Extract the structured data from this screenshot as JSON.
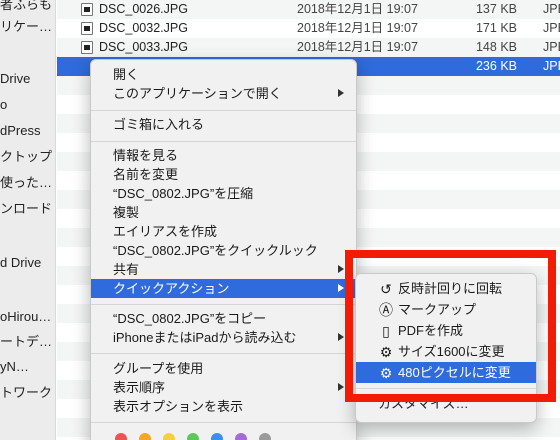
{
  "sidebar": {
    "items": [
      {
        "label": "者ふらも"
      },
      {
        "label": "リケー…"
      },
      {
        "label": "Drive"
      },
      {
        "label": "o"
      },
      {
        "label": "dPress"
      },
      {
        "label": "クトップ"
      },
      {
        "label": "使った…"
      },
      {
        "label": "ンロード"
      },
      {
        "label": "d Drive"
      },
      {
        "label": "oHirou…"
      },
      {
        "label": "ートデ…"
      },
      {
        "label": "yN…"
      },
      {
        "label": "トワーク"
      }
    ]
  },
  "files": [
    {
      "name": "DSC_0026.JPG",
      "date": "2018年12月1日 19:07",
      "size": "137 KB",
      "kind": "JPE"
    },
    {
      "name": "DSC_0032.JPG",
      "date": "2018年12月1日 19:07",
      "size": "171 KB",
      "kind": "JPE"
    },
    {
      "name": "DSC_0033.JPG",
      "date": "2018年12月1日 19:07",
      "size": "148 KB",
      "kind": "JPE"
    },
    {
      "name": "",
      "date": "",
      "size": "236 KB",
      "kind": "JPE"
    }
  ],
  "context_menu": {
    "open": "開く",
    "open_with": "このアプリケーションで開く",
    "trash": "ゴミ箱に入れる",
    "get_info": "情報を見る",
    "rename": "名前を変更",
    "compress": "“DSC_0802.JPG”を圧縮",
    "duplicate": "複製",
    "make_alias": "エイリアスを作成",
    "quick_look": "“DSC_0802.JPG”をクイックルック",
    "share": "共有",
    "quick_actions": "クイックアクション",
    "copy": "“DSC_0802.JPG”をコピー",
    "import_iphone": "iPhoneまたはiPadから読み込む",
    "use_groups": "グループを使用",
    "sort_by": "表示順序",
    "show_view_options": "表示オプションを表示"
  },
  "tag_colors": [
    "#ef5350",
    "#f5a623",
    "#f4d03f",
    "#5bc85b",
    "#3b8ff0",
    "#a66bd6",
    "#9b9b9b"
  ],
  "submenu": {
    "items": [
      {
        "label": "反時計回りに回転",
        "icon": "rotate-left-icon"
      },
      {
        "label": "マークアップ",
        "icon": "markup-pen-icon"
      },
      {
        "label": "PDFを作成",
        "icon": "pdf-document-icon"
      },
      {
        "label": "サイズ1600に変更",
        "icon": "gear-icon"
      },
      {
        "label": "480ピクセルに変更",
        "icon": "gear-icon"
      }
    ],
    "customize": "カスタマイズ…"
  },
  "colors": {
    "selection_blue": "#2f6bdc",
    "annotation_red": "#f21b05"
  }
}
